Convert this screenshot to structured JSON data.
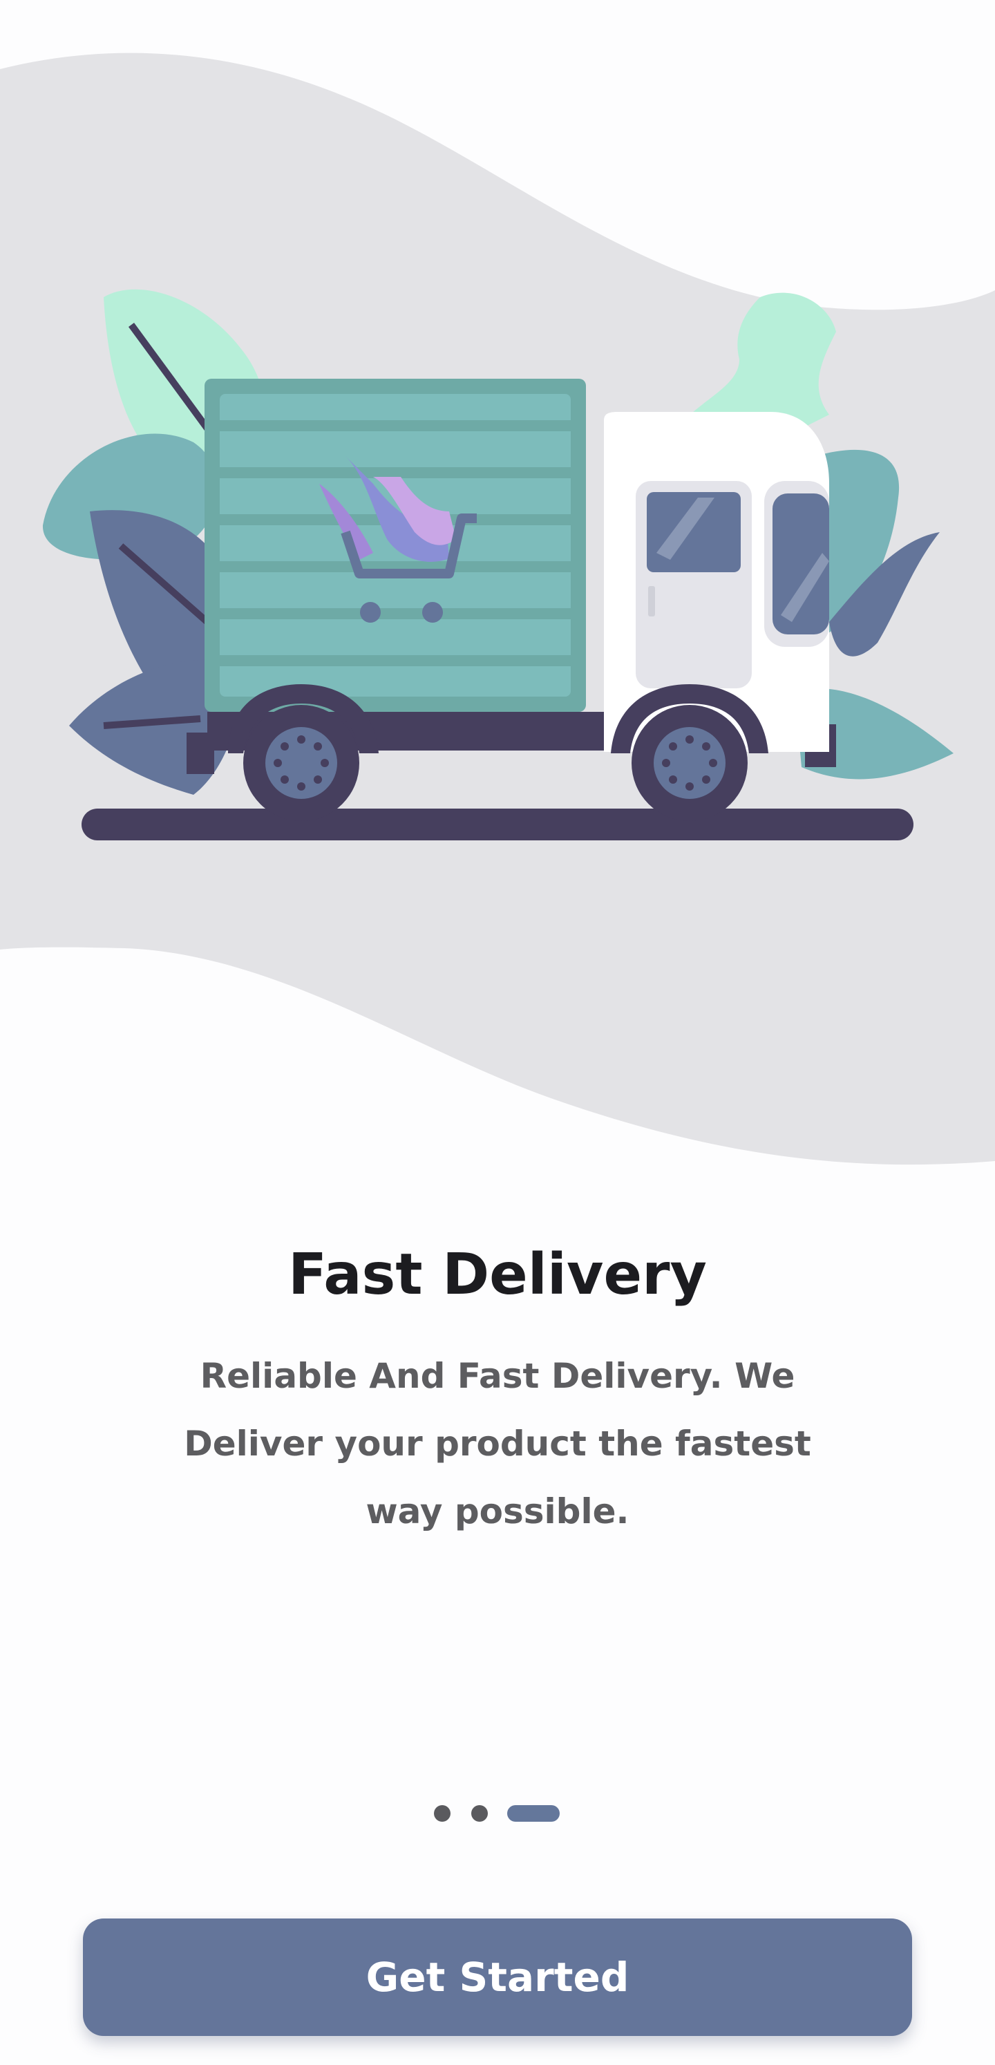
{
  "onboarding": {
    "title": "Fast Delivery",
    "description": "Reliable And Fast Delivery. We Deliver your product the fastest way possible.",
    "pager": {
      "total_pages": 3,
      "current_page": 3
    },
    "cta_label": "Get Started"
  },
  "illustration": {
    "subject": "delivery-truck-with-shopping-cart-logo",
    "icons": [
      "truck-icon",
      "shopping-cart-icon",
      "leaf-icon"
    ]
  },
  "colors": {
    "background": "#fdfdfe",
    "wave": "#e3e3e6",
    "accent": "#64759a",
    "title_text": "#1c1c20",
    "body_text": "#5d5d60",
    "truck_cargo": "#7dbcbb",
    "truck_dark": "#463f5e"
  }
}
